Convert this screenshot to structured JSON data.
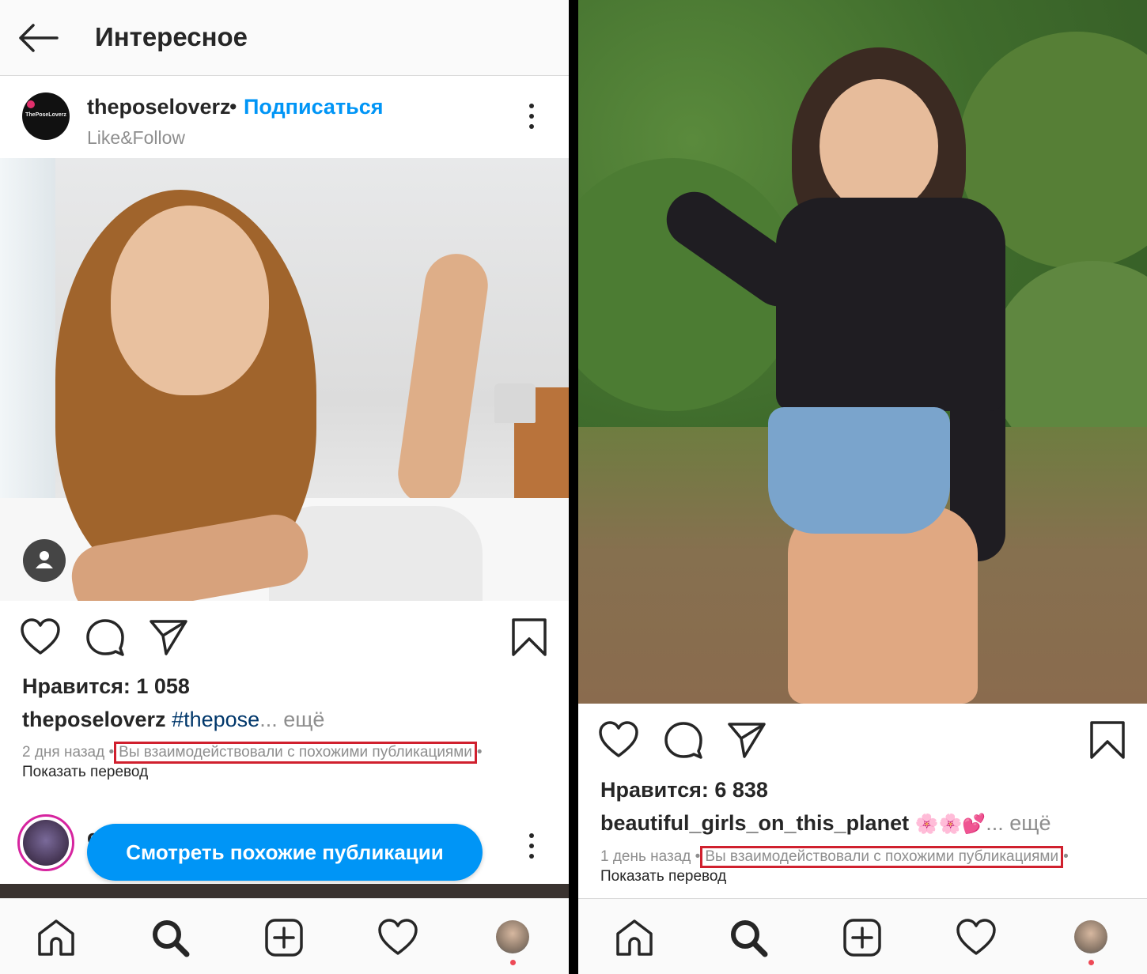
{
  "left": {
    "header": {
      "title": "Интересное"
    },
    "post": {
      "username": "theposeloverz",
      "separator": "•",
      "follow_label": "Подписаться",
      "subtitle": "Like&Follow",
      "avatar_text": "ThePoseLoverz",
      "likes": "Нравится: 1 058",
      "caption_user": "theposeloverz",
      "caption_tag": "#thepose",
      "caption_more": "... ещё",
      "time": "2 дня назад",
      "meta_sep": "•",
      "interaction_note": "Вы взаимодействовали с похожими публикациями",
      "meta_sep_end": "•",
      "translate": "Показать перевод"
    },
    "next_post": {
      "peek_user": "c",
      "similar_button": "Смотреть похожие публикации"
    }
  },
  "right": {
    "post": {
      "likes": "Нравится: 6 838",
      "caption_user": "beautiful_girls_on_this_planet",
      "caption_emoji": "🌸🌸💕",
      "caption_more": "... ещё",
      "time": "1 день назад",
      "meta_sep": "•",
      "interaction_note": "Вы взаимодействовали с похожими публикациями",
      "meta_sep_end": "•",
      "translate": "Показать перевод"
    }
  },
  "colors": {
    "accent_blue": "#0095f6",
    "highlight_red": "#d0202e",
    "notification_red": "#ed4956",
    "text_dark": "#262626",
    "text_gray": "#8e8e8e"
  },
  "icons": {
    "back": "back-arrow-icon",
    "more": "more-vertical-icon",
    "tag": "person-tag-icon",
    "like": "heart-icon",
    "comment": "comment-icon",
    "share": "send-icon",
    "save": "bookmark-icon",
    "home": "home-icon",
    "search": "search-icon",
    "add": "add-post-icon",
    "activity": "activity-heart-icon"
  }
}
